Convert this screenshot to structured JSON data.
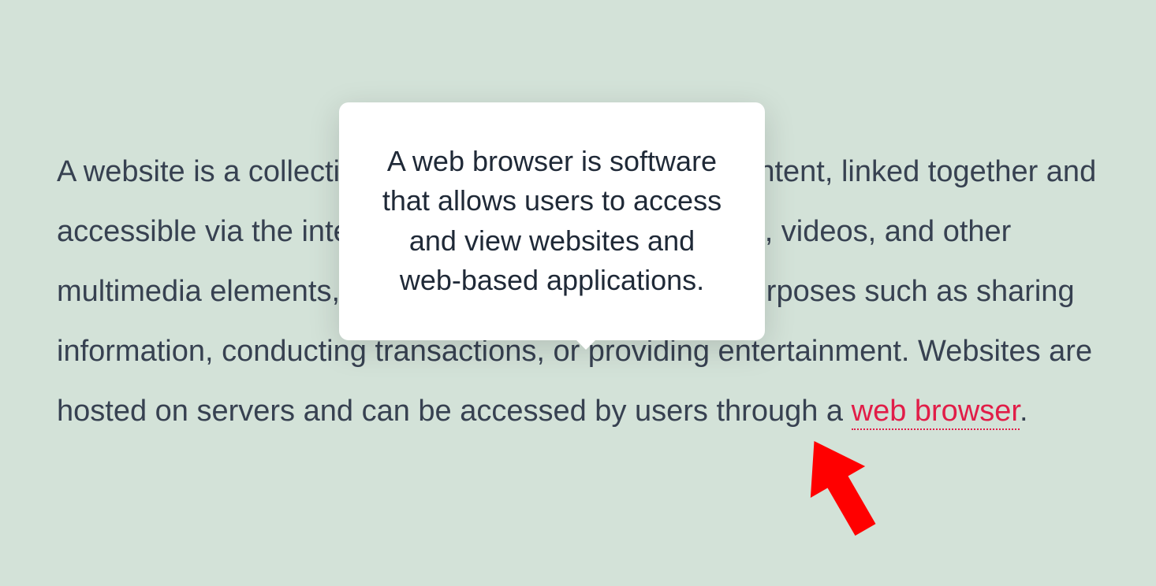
{
  "paragraph": {
    "text_before_link": "A website is a collection of web pages and related content, linked together and accessible via the internet. It can include text, images, videos, and other multimedia elements, and is often used for various purposes such as sharing information, conducting transactions, or providing entertainment. Websites are hosted on servers and can be accessed by users through a ",
    "link_text": "web browser",
    "text_after_link": "."
  },
  "tooltip": {
    "text": "A web browser is software that allows users to access and view websites and web-based applications."
  },
  "colors": {
    "background": "#d3e2d8",
    "text": "#374151",
    "link": "#e11d48",
    "tooltip_bg": "#ffffff",
    "cursor": "#ff0000"
  }
}
